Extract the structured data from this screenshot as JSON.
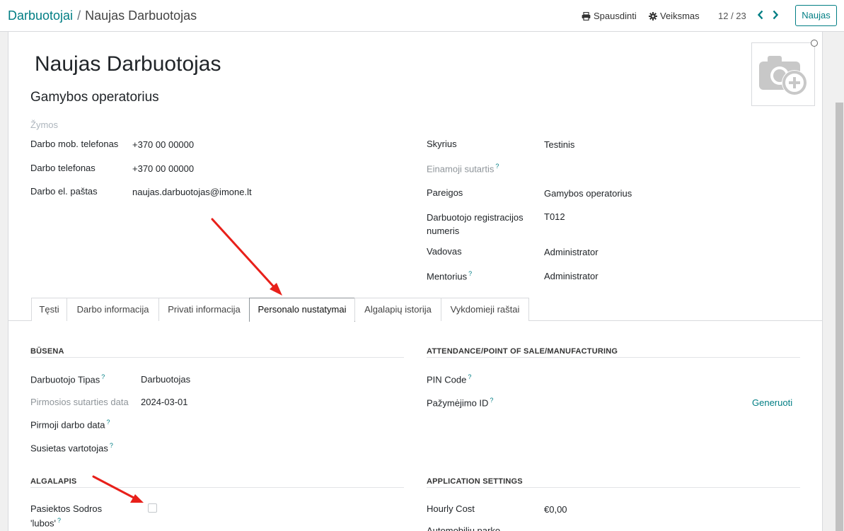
{
  "breadcrumb": {
    "parent": "Darbuotojai",
    "separator": "/",
    "current": "Naujas Darbuotojas"
  },
  "actions": {
    "print": "Spausdinti",
    "action": "Veiksmas",
    "new": "Naujas"
  },
  "pager": {
    "value": "12 / 23"
  },
  "employee": {
    "name": "Naujas Darbuotojas",
    "job_title": "Gamybos operatorius",
    "tags_placeholder": "Žymos"
  },
  "left_fields": [
    {
      "label": "Darbo mob. telefonas",
      "value": "+370 00 00000"
    },
    {
      "label": "Darbo telefonas",
      "value": "+370 00 00000"
    },
    {
      "label": "Darbo el. paštas",
      "value": "naujas.darbuotojas@imone.lt"
    }
  ],
  "right_fields": [
    {
      "label": "Skyrius",
      "value": "Testinis",
      "help": ""
    },
    {
      "label": "Einamoji sutartis",
      "value": "",
      "help": "?"
    },
    {
      "label": "Pareigos",
      "value": "Gamybos operatorius",
      "help": ""
    },
    {
      "label": "Darbuotojo registracijos numeris",
      "value": "T012",
      "help": ""
    },
    {
      "label": "Vadovas",
      "value": "Administrator",
      "help": ""
    },
    {
      "label": "Mentorius",
      "value": "Administrator",
      "help": "?"
    }
  ],
  "tabs": [
    "Tęsti",
    "Darbo informacija",
    "Privati informacija",
    "Personalo nustatymai",
    "Algalapių istorija",
    "Vykdomieji raštai"
  ],
  "active_tab": "Personalo nustatymai",
  "status_section": {
    "title": "BŪSENA",
    "fields": [
      {
        "label": "Darbuotojo Tipas",
        "help": "?",
        "value": "Darbuotojas"
      },
      {
        "label": "Pirmosios sutarties data",
        "help": "",
        "value": "2024-03-01"
      },
      {
        "label": "Pirmoji darbo data",
        "help": "?",
        "value": ""
      },
      {
        "label": "Susietas vartotojas",
        "help": "?",
        "value": ""
      }
    ]
  },
  "attendance_section": {
    "title": "ATTENDANCE/POINT OF SALE/MANUFACTURING",
    "fields": [
      {
        "label": "PIN Code",
        "help": "?",
        "value": ""
      },
      {
        "label": "Pažymėjimo ID",
        "help": "?",
        "value": ""
      }
    ],
    "generate_label": "Generuoti"
  },
  "payslip_section": {
    "title": "ALGALAPIS",
    "fields": [
      {
        "label_line1": "Pasiektos Sodros",
        "label_line2": "'lubos'",
        "help": "?",
        "checked": false
      }
    ]
  },
  "app_settings_section": {
    "title": "APPLICATION SETTINGS",
    "fields": [
      {
        "label": "Hourly Cost",
        "value": "€0,00"
      },
      {
        "label": "Automobilių parko",
        "value": ""
      }
    ]
  },
  "colors": {
    "accent": "#017e84",
    "annotation_arrow": "#e8201a"
  },
  "icons": {
    "print": "printer-icon",
    "action": "gear-icon",
    "prev": "chevron-left-icon",
    "next": "chevron-right-icon",
    "avatar": "camera-plus-icon"
  }
}
